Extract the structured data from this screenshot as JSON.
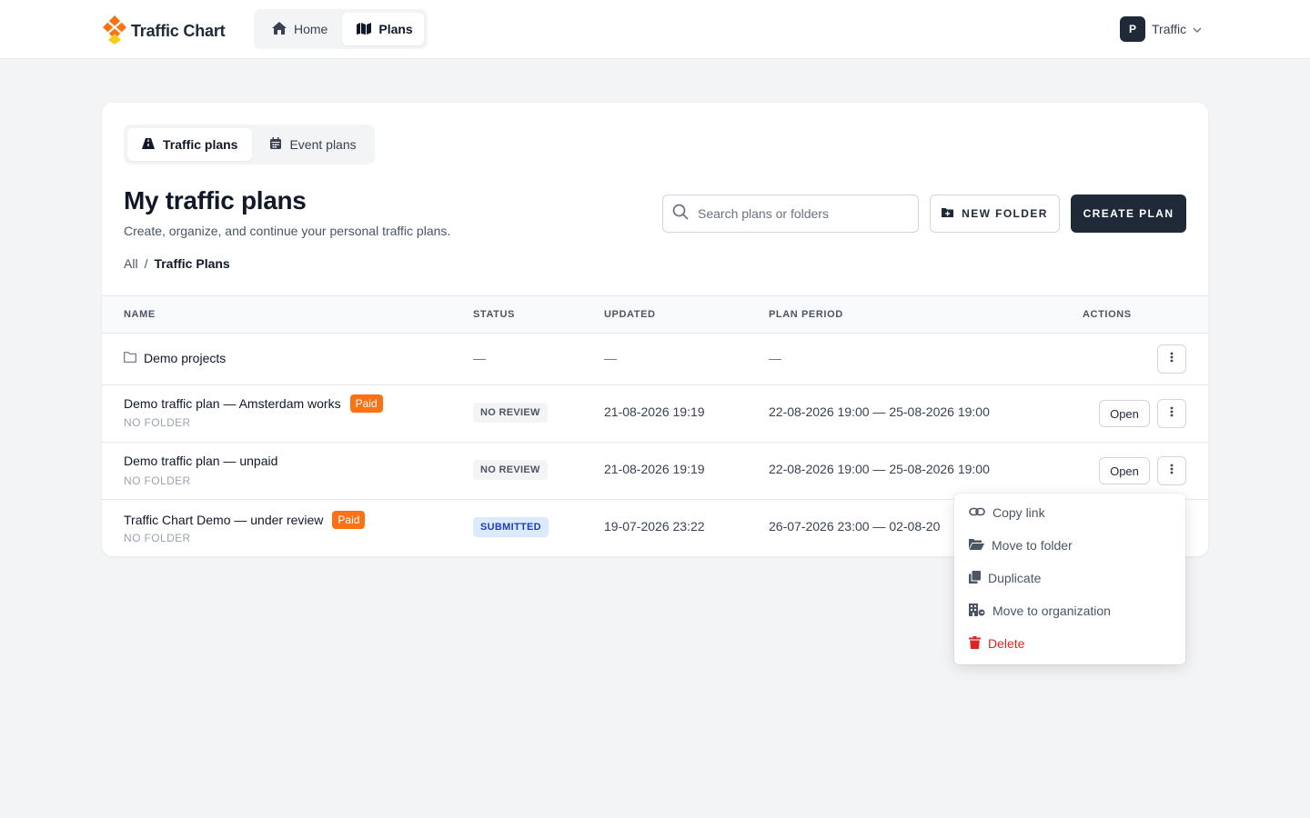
{
  "app": {
    "brand_name": "Traffic Chart"
  },
  "topnav": {
    "items": [
      {
        "label": "Home"
      },
      {
        "label": "Plans"
      }
    ]
  },
  "user": {
    "initial": "P",
    "name": "Traffic"
  },
  "tabs": {
    "items": [
      {
        "label": "Traffic plans"
      },
      {
        "label": "Event plans"
      }
    ]
  },
  "page": {
    "title": "My traffic plans",
    "subtitle": "Create, organize, and continue your personal traffic plans.",
    "breadcrumb": {
      "root": "All",
      "separator": "/",
      "current": "Traffic Plans"
    }
  },
  "search": {
    "placeholder": "Search plans or folders",
    "value": ""
  },
  "buttons": {
    "new_folder": "NEW FOLDER",
    "create_plan": "CREATE PLAN",
    "open": "Open"
  },
  "table": {
    "headers": {
      "name": "NAME",
      "status": "STATUS",
      "updated": "UPDATED",
      "period": "PLAN PERIOD",
      "actions": "ACTIONS"
    },
    "empty": "—",
    "folder": {
      "name": "Demo projects"
    },
    "plans": [
      {
        "name": "Demo traffic plan — Amsterdam works",
        "paid": "Paid",
        "folder": "NO FOLDER",
        "status": "NO REVIEW",
        "updated": "21-08-2026 19:19",
        "period": "22-08-2026 19:00 — 25-08-2026 19:00"
      },
      {
        "name": "Demo traffic plan — unpaid",
        "paid": "",
        "folder": "NO FOLDER",
        "status": "NO REVIEW",
        "updated": "21-08-2026 19:19",
        "period": "22-08-2026 19:00 — 25-08-2026 19:00"
      },
      {
        "name": "Traffic Chart Demo — under review",
        "paid": "Paid",
        "folder": "NO FOLDER",
        "status": "SUBMITTED",
        "updated": "19-07-2026 23:22",
        "period": "26-07-2026 23:00 — 02-08-20"
      }
    ]
  },
  "menu": {
    "items": [
      {
        "label": "Copy link"
      },
      {
        "label": "Move to folder"
      },
      {
        "label": "Duplicate"
      },
      {
        "label": "Move to organization"
      },
      {
        "label": "Delete"
      }
    ]
  },
  "colors": {
    "accent": "#f97316",
    "brand_yellow": "#facc15",
    "dark": "#1f2937",
    "danger": "#dc2626",
    "submitted_bg": "#dbeafe"
  }
}
